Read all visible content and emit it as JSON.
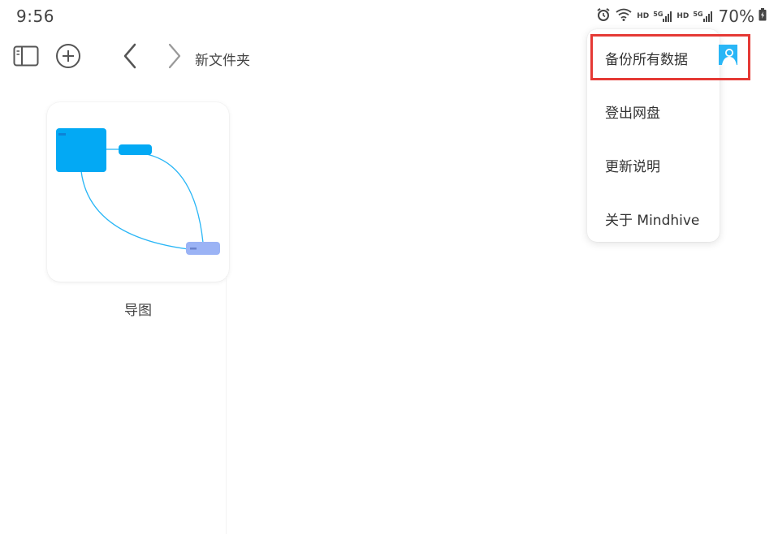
{
  "status_bar": {
    "time": "9:56",
    "signal1_label": "5G",
    "signal2_label": "5G",
    "hd1": "HD",
    "hd2": "HD",
    "battery": "70%"
  },
  "toolbar": {
    "folder_title": "新文件夹"
  },
  "file_card": {
    "name": "导图"
  },
  "menu": {
    "items": [
      {
        "label": "备份所有数据"
      },
      {
        "label": "登出网盘"
      },
      {
        "label": "更新说明"
      },
      {
        "label": "关于 Mindhive"
      }
    ]
  },
  "colors": {
    "accent_blue": "#03a9f4",
    "node_secondary": "#9bb3f5",
    "highlight_red": "#e53935",
    "text": "#333333"
  }
}
